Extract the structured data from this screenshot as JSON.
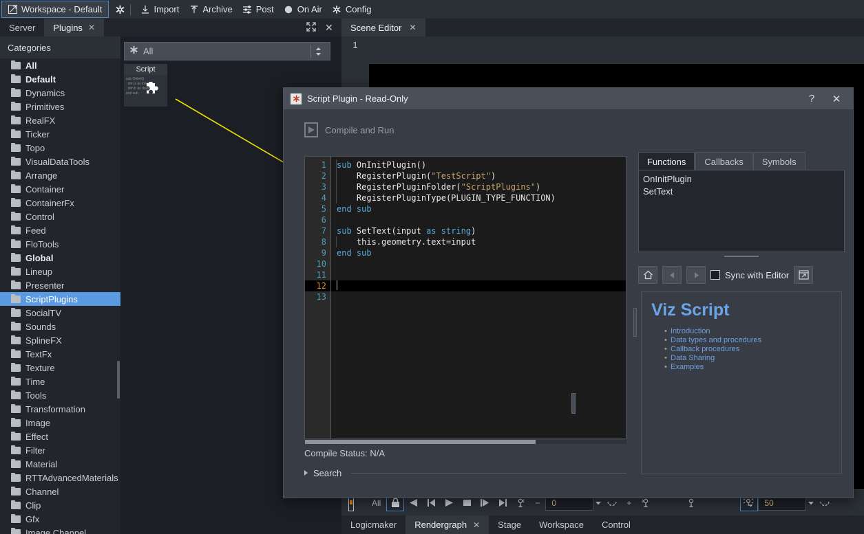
{
  "topbar": {
    "workspace_label": "Workspace - Default",
    "workspace_icon": "window-icon",
    "settings_icon": "gear-asterisk-icon",
    "items": [
      {
        "label": "Import",
        "icon": "import-icon"
      },
      {
        "label": "Archive",
        "icon": "archive-icon"
      },
      {
        "label": "Post",
        "icon": "post-sliders-icon"
      },
      {
        "label": "On Air",
        "icon": "on-air-circle-icon"
      },
      {
        "label": "Config",
        "icon": "config-gear-icon"
      }
    ]
  },
  "left_panel": {
    "tabs": [
      {
        "label": "Server",
        "active": false,
        "closable": false
      },
      {
        "label": "Plugins",
        "active": true,
        "closable": true,
        "close_glyph": "✕"
      }
    ],
    "tools": [
      {
        "icon": "expand-icon",
        "glyph": "⤢"
      },
      {
        "icon": "close-icon",
        "glyph": "✕"
      }
    ],
    "categories_header": "Categories",
    "categories": [
      {
        "label": "All",
        "bold": true,
        "selected": false
      },
      {
        "label": "Default",
        "bold": true,
        "selected": false
      },
      {
        "label": "Dynamics",
        "bold": false,
        "selected": false
      },
      {
        "label": "Primitives",
        "bold": false,
        "selected": false
      },
      {
        "label": "RealFX",
        "bold": false,
        "selected": false
      },
      {
        "label": "Ticker",
        "bold": false,
        "selected": false
      },
      {
        "label": "Topo",
        "bold": false,
        "selected": false
      },
      {
        "label": "VisualDataTools",
        "bold": false,
        "selected": false
      },
      {
        "label": "Arrange",
        "bold": false,
        "selected": false
      },
      {
        "label": "Container",
        "bold": false,
        "selected": false
      },
      {
        "label": "ContainerFx",
        "bold": false,
        "selected": false
      },
      {
        "label": "Control",
        "bold": false,
        "selected": false
      },
      {
        "label": "Feed",
        "bold": false,
        "selected": false
      },
      {
        "label": "FloTools",
        "bold": false,
        "selected": false
      },
      {
        "label": "Global",
        "bold": true,
        "selected": false
      },
      {
        "label": "Lineup",
        "bold": false,
        "selected": false
      },
      {
        "label": "Presenter",
        "bold": false,
        "selected": false
      },
      {
        "label": "ScriptPlugins",
        "bold": false,
        "selected": true
      },
      {
        "label": "SocialTV",
        "bold": false,
        "selected": false
      },
      {
        "label": "Sounds",
        "bold": false,
        "selected": false
      },
      {
        "label": "SplineFX",
        "bold": false,
        "selected": false
      },
      {
        "label": "TextFx",
        "bold": false,
        "selected": false
      },
      {
        "label": "Texture",
        "bold": false,
        "selected": false
      },
      {
        "label": "Time",
        "bold": false,
        "selected": false
      },
      {
        "label": "Tools",
        "bold": false,
        "selected": false
      },
      {
        "label": "Transformation",
        "bold": false,
        "selected": false
      },
      {
        "label": "Image",
        "bold": false,
        "selected": false
      },
      {
        "label": "Effect",
        "bold": false,
        "selected": false
      },
      {
        "label": "Filter",
        "bold": false,
        "selected": false
      },
      {
        "label": "Material",
        "bold": false,
        "selected": false
      },
      {
        "label": "RTTAdvancedMaterials",
        "bold": false,
        "selected": false
      },
      {
        "label": "Channel",
        "bold": false,
        "selected": false
      },
      {
        "label": "Clip",
        "bold": false,
        "selected": false
      },
      {
        "label": "Gfx",
        "bold": false,
        "selected": false
      },
      {
        "label": "Image Channel",
        "bold": false,
        "selected": false
      }
    ],
    "filter": {
      "value": "All",
      "icon": "asterisk-icon"
    },
    "plugin_tile": {
      "name": "Script",
      "icon": "puzzle-piece-icon",
      "thumb_text": "sub OnInit()\n   dim a as integer\n   dim b as double\nend sub"
    }
  },
  "scene_editor": {
    "tab_label": "Scene Editor",
    "close_glyph": "✕",
    "camera_number": "1"
  },
  "bottom_toolbar": {
    "all_label": "All",
    "buttons": [
      {
        "icon": "lock-icon",
        "selected": true
      },
      {
        "icon": "play-reverse-icon",
        "selected": false
      },
      {
        "icon": "jump-start-icon",
        "selected": false
      },
      {
        "icon": "play-icon",
        "selected": false
      },
      {
        "icon": "stop-icon",
        "selected": false
      },
      {
        "icon": "step-forward-icon",
        "selected": false
      },
      {
        "icon": "jump-end-icon",
        "selected": false
      },
      {
        "icon": "key-prev-icon",
        "selected": false
      }
    ],
    "minus_glyph": "−",
    "field_1_value": "0",
    "plus_glyph": "+",
    "field_2_value": "50",
    "icons_after": [
      {
        "icon": "loop-icon"
      },
      {
        "icon": "key-next-icon"
      },
      {
        "icon": "key-icon"
      },
      {
        "icon": "spotlight-icon",
        "selected": true
      },
      {
        "icon": "loop2-icon"
      }
    ]
  },
  "bottom_tabs": [
    {
      "label": "Logicmaker",
      "active": false,
      "closable": false
    },
    {
      "label": "Rendergraph",
      "active": true,
      "closable": true,
      "close_glyph": "✕"
    },
    {
      "label": "Stage",
      "active": false,
      "closable": false
    },
    {
      "label": "Workspace",
      "active": false,
      "closable": false
    },
    {
      "label": "Control",
      "active": false,
      "closable": false
    }
  ],
  "dialog": {
    "title": "Script Plugin - Read-Only",
    "title_icon": "asterisk-red-icon",
    "help_glyph": "?",
    "close_glyph": "✕",
    "compile_run_label": "Compile and Run",
    "compile_run_icon": "play-file-icon",
    "compile_status": "Compile Status: N/A",
    "search_label": "Search",
    "search_icon": "triangle-right-icon",
    "code": {
      "current_line": 12,
      "total_lines": 13,
      "lines": [
        {
          "n": 1,
          "text": "sub OnInitPlugin()"
        },
        {
          "n": 2,
          "text": "    RegisterPlugin(\"TestScript\")"
        },
        {
          "n": 3,
          "text": "    RegisterPluginFolder(\"ScriptPlugins\")"
        },
        {
          "n": 4,
          "text": "    RegisterPluginType(PLUGIN_TYPE_FUNCTION)"
        },
        {
          "n": 5,
          "text": "end sub"
        },
        {
          "n": 6,
          "text": ""
        },
        {
          "n": 7,
          "text": "sub SetText(input as string)"
        },
        {
          "n": 8,
          "text": "    this.geometry.text=input"
        },
        {
          "n": 9,
          "text": "end sub"
        },
        {
          "n": 10,
          "text": ""
        },
        {
          "n": 11,
          "text": ""
        },
        {
          "n": 12,
          "text": ""
        },
        {
          "n": 13,
          "text": ""
        }
      ]
    },
    "right_pane": {
      "tabs": [
        {
          "label": "Functions",
          "active": true
        },
        {
          "label": "Callbacks",
          "active": false
        },
        {
          "label": "Symbols",
          "active": false
        }
      ],
      "list_items": [
        "OnInitPlugin",
        "SetText"
      ],
      "nav": {
        "home_icon": "home-icon",
        "back_icon": "arrow-left-icon",
        "forward_icon": "arrow-right-icon",
        "sync_label": "Sync with Editor",
        "sync_checked": false,
        "popout_icon": "popout-window-icon"
      },
      "help": {
        "title": "Viz Script",
        "links": [
          "Introduction",
          "Data types and procedures",
          "Callback procedures",
          "Data Sharing",
          "Examples"
        ]
      }
    }
  },
  "colors": {
    "accent_blue": "#5a9ae2",
    "selection_blue": "#4f87c4",
    "arrow_yellow": "#e8e000",
    "keyword_blue": "#5aa9d8",
    "string_tan": "#c9a26d",
    "link_blue": "#6f9fe0",
    "panel_bg": "#2b2f36",
    "dark_bg": "#1b1e24",
    "dialog_bg": "#383d45"
  }
}
